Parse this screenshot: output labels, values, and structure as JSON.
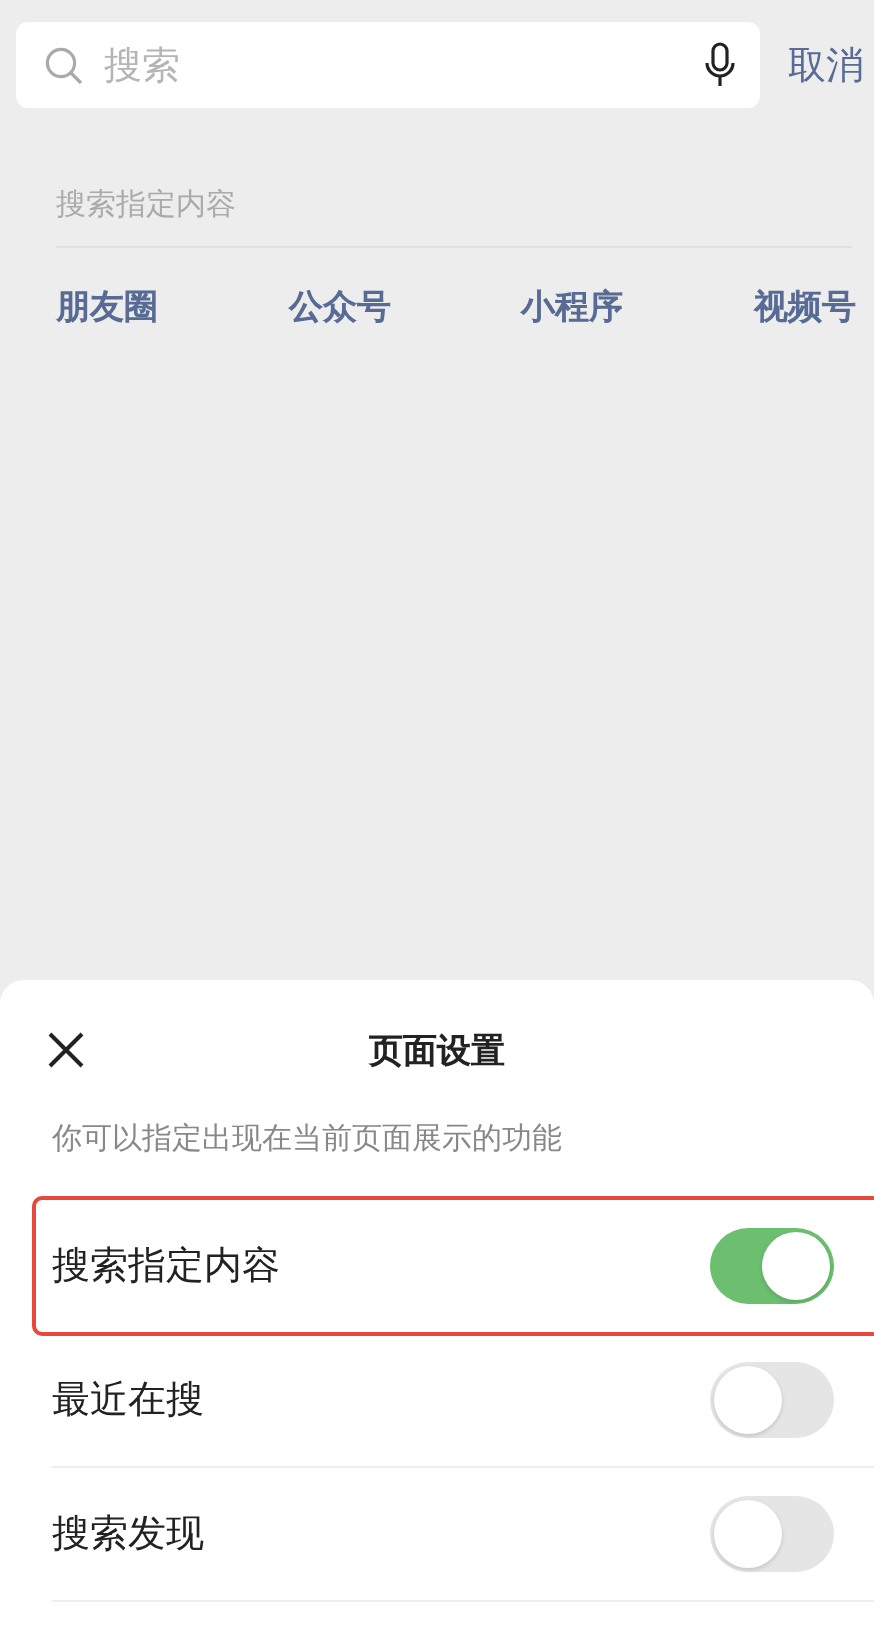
{
  "search": {
    "placeholder": "搜索",
    "cancel": "取消"
  },
  "section": {
    "title": "搜索指定内容",
    "categories": [
      "朋友圈",
      "公众号",
      "小程序",
      "视频号"
    ]
  },
  "sheet": {
    "title": "页面设置",
    "description": "你可以指定出现在当前页面展示的功能",
    "options": [
      {
        "label": "搜索指定内容",
        "on": true,
        "highlighted": true
      },
      {
        "label": "最近在搜",
        "on": false,
        "highlighted": false
      },
      {
        "label": "搜索发现",
        "on": false,
        "highlighted": false
      }
    ]
  }
}
